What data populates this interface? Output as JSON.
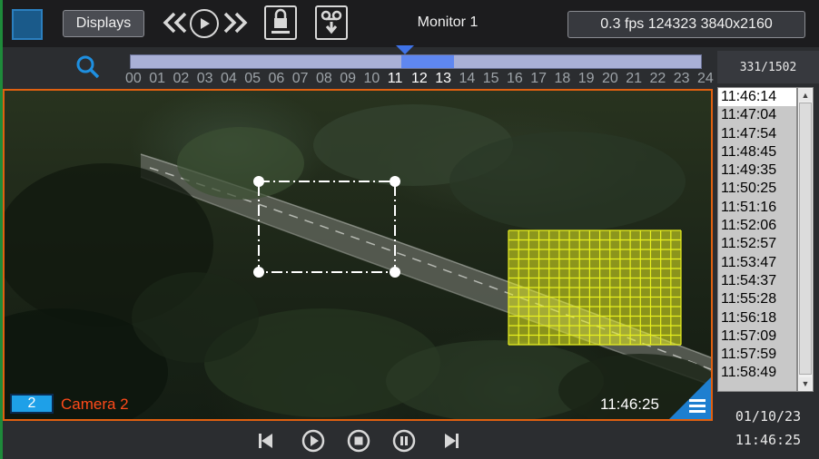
{
  "toolbar": {
    "displays_label": "Displays",
    "monitor_title": "Monitor 1",
    "status": "0.3 fps 124323 3840x2160",
    "icons": [
      "app-icon",
      "rewind-icon",
      "play-icon",
      "fast-forward-icon",
      "lock-icon",
      "tape-download-icon"
    ]
  },
  "timeline": {
    "hours": [
      "00",
      "01",
      "02",
      "03",
      "04",
      "05",
      "06",
      "07",
      "08",
      "09",
      "10",
      "11",
      "12",
      "13",
      "14",
      "15",
      "16",
      "17",
      "18",
      "19",
      "20",
      "21",
      "22",
      "23",
      "24"
    ],
    "active_hours": [
      "11",
      "12",
      "13"
    ],
    "selection_start_hour": 12,
    "selection_end_hour": 13.6,
    "marker_hour": 12
  },
  "frame_counter": "331/1502",
  "camera": {
    "number": "2",
    "name": "Camera 2",
    "timestamp": "11:46:25"
  },
  "time_list": {
    "items": [
      "11:46:14",
      "11:47:04",
      "11:47:54",
      "11:48:45",
      "11:49:35",
      "11:50:25",
      "11:51:16",
      "11:52:06",
      "11:52:57",
      "11:53:47",
      "11:54:37",
      "11:55:28",
      "11:56:18",
      "11:57:09",
      "11:57:59",
      "11:58:49"
    ],
    "selected": "11:46:14"
  },
  "current": {
    "date": "01/10/23",
    "time": "11:46:25"
  },
  "playback": {
    "icons": [
      "step-back-icon",
      "play-icon",
      "stop-icon",
      "pause-icon",
      "step-forward-icon"
    ]
  },
  "colors": {
    "accent_orange": "#e06010",
    "camera_label": "#ff4a1a",
    "camera_badge": "#1ea0e8",
    "motion_grid": "#e8f020",
    "timeline_selection": "#5f87f0"
  }
}
